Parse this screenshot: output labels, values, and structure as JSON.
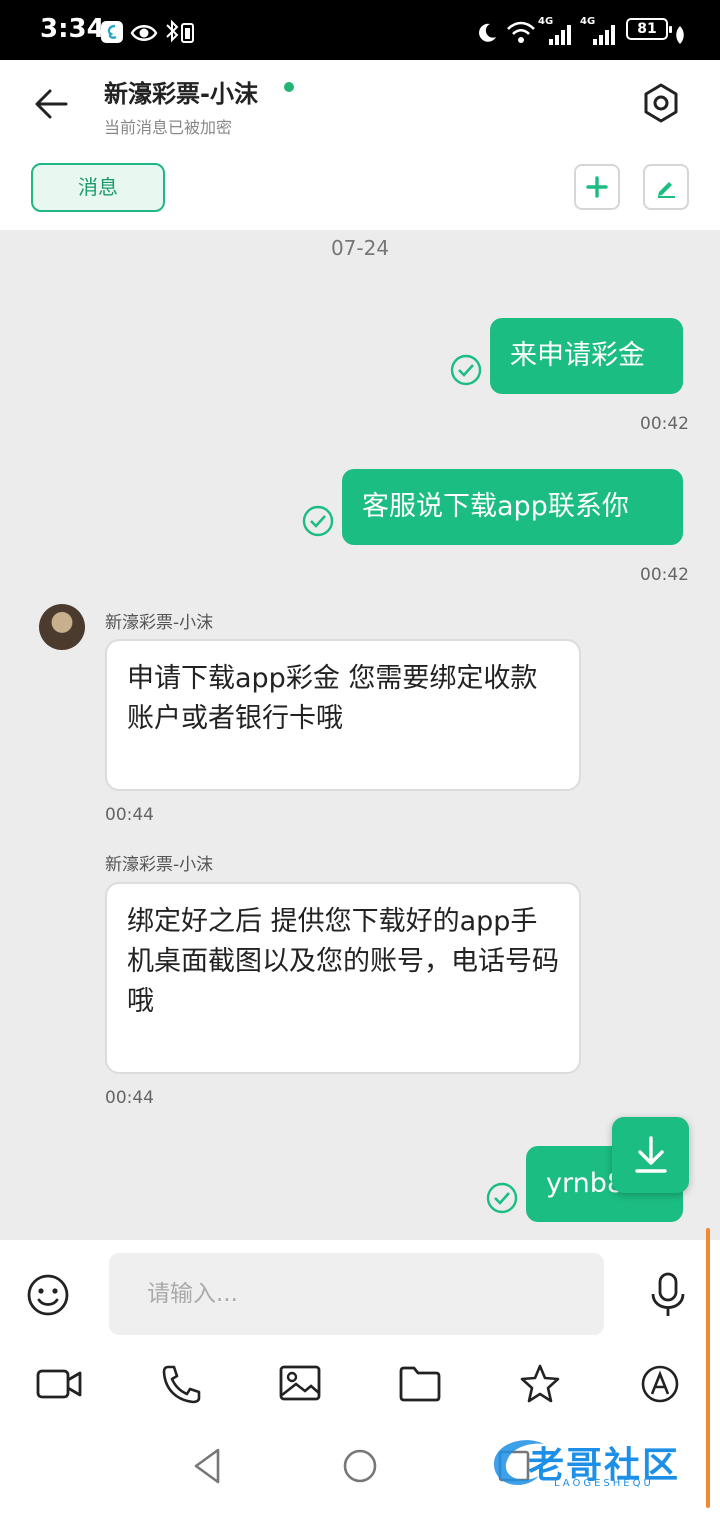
{
  "status_bar": {
    "time": "3:34",
    "network_1": "4G",
    "network_2": "4G",
    "battery": "81"
  },
  "header": {
    "title": "新濠彩票-小沫",
    "subtitle": "当前消息已被加密",
    "tab_label": "消息",
    "online_color": "#22b573"
  },
  "chat": {
    "date": "07-24",
    "messages": [
      {
        "direction": "out",
        "text": "来申请彩金",
        "time": "00:42"
      },
      {
        "direction": "out",
        "text": "客服说下载app联系你",
        "time": "00:42"
      },
      {
        "direction": "in",
        "sender": "新濠彩票-小沫",
        "text": "申请下载app彩金 您需要绑定收款账户或者银行卡哦",
        "time": "00:44"
      },
      {
        "direction": "in",
        "sender": "新濠彩票-小沫",
        "text": "绑定好之后 提供您下载好的app手机桌面截图以及您的账号，电话号码哦",
        "time": "00:44"
      },
      {
        "direction": "out",
        "text": "yrnb888",
        "time": ""
      }
    ]
  },
  "input": {
    "placeholder": "请输入..."
  },
  "toolbar": {
    "icons": [
      "video-icon",
      "phone-icon",
      "image-icon",
      "folder-icon",
      "star-icon",
      "translate-icon"
    ]
  },
  "watermark": {
    "text": "老哥社区",
    "sub": "LAOGESHEQU"
  },
  "colors": {
    "accent": "#1bbd82",
    "accent_dark": "#1a9a6d"
  }
}
